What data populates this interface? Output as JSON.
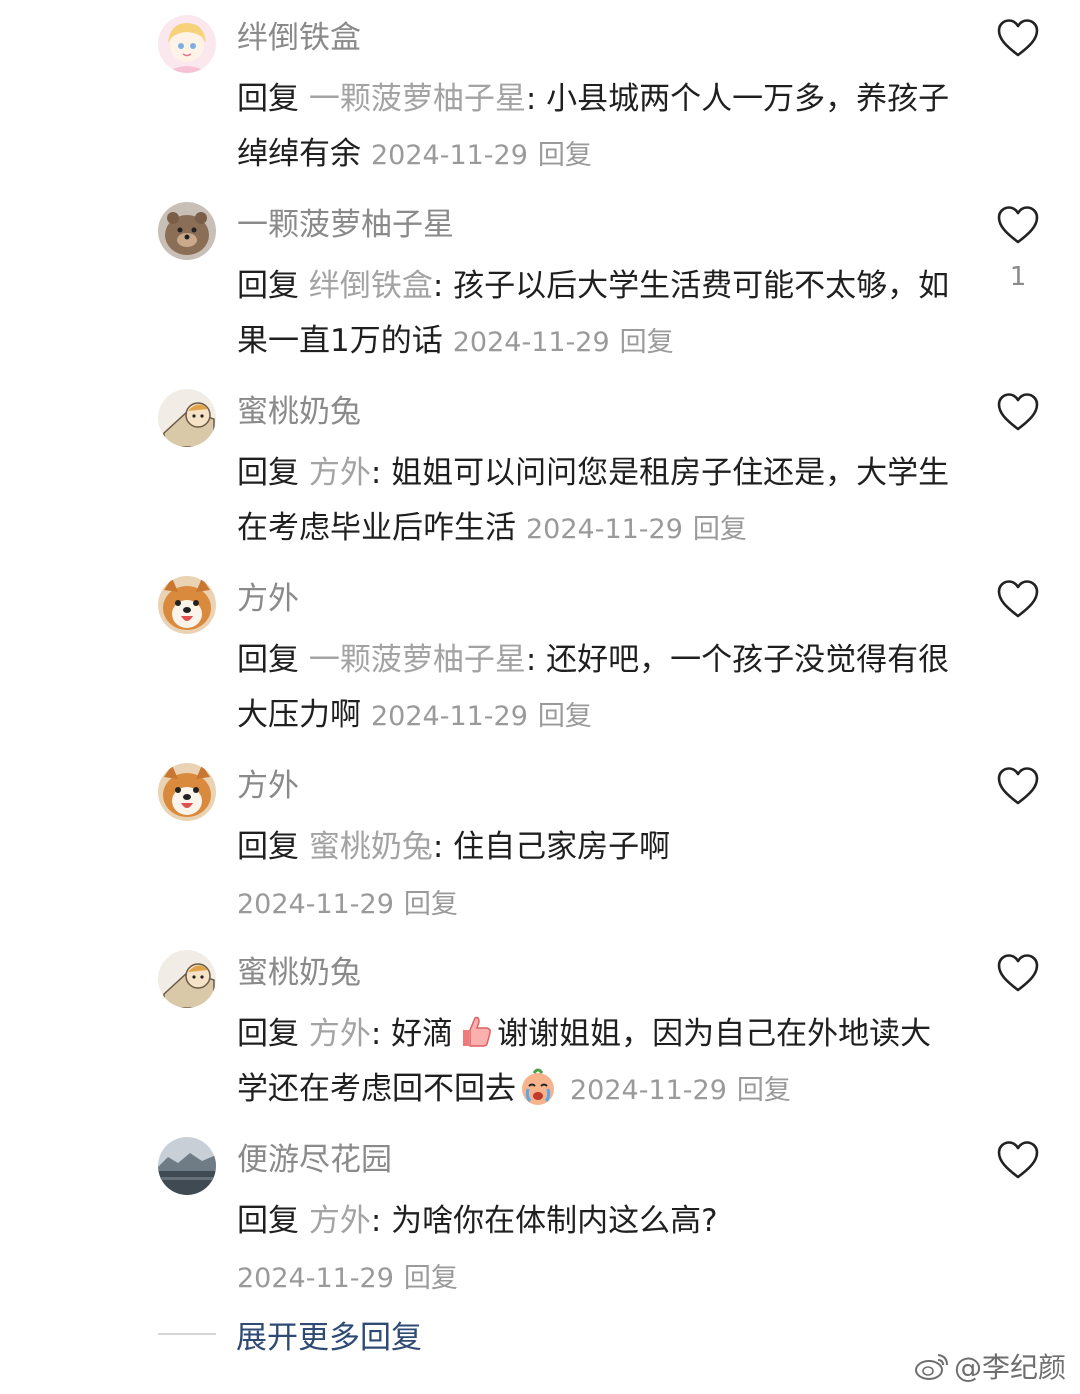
{
  "comments": [
    {
      "username": "绊倒铁盒",
      "prefix": "回复 ",
      "target": "一颗菠萝柚子星",
      "colon": ": ",
      "text": "小县城两个人一万多，养孩子绰绰有余",
      "date": "2024-11-29",
      "reply": "回复",
      "likes": ""
    },
    {
      "username": "一颗菠萝柚子星",
      "prefix": "回复 ",
      "target": "绊倒铁盒",
      "colon": ": ",
      "text": "孩子以后大学生活费可能不太够，如果一直1万的话",
      "date": "2024-11-29",
      "reply": "回复",
      "likes": "1"
    },
    {
      "username": "蜜桃奶兔",
      "prefix": "回复 ",
      "target": "方外",
      "colon": ": ",
      "text": "姐姐可以问问您是租房子住还是，大学生在考虑毕业后咋生活",
      "date": "2024-11-29",
      "reply": "回复",
      "likes": ""
    },
    {
      "username": "方外",
      "prefix": "回复 ",
      "target": "一颗菠萝柚子星",
      "colon": ": ",
      "text": "还好吧，一个孩子没觉得有很大压力啊",
      "date": "2024-11-29",
      "reply": "回复",
      "likes": ""
    },
    {
      "username": "方外",
      "prefix": "回复 ",
      "target": "蜜桃奶兔",
      "colon": ": ",
      "text": "住自己家房子啊",
      "date": "2024-11-29",
      "reply": "回复",
      "likes": ""
    },
    {
      "username": "蜜桃奶兔",
      "prefix": "回复 ",
      "target": "方外",
      "colon": ": ",
      "text_a": "好滴",
      "text_b": "谢谢姐姐，因为自己在外地读大学还在考虑回不回去",
      "date": "2024-11-29",
      "reply": "回复",
      "likes": ""
    },
    {
      "username": "便游尽花园",
      "prefix": "回复 ",
      "target": "方外",
      "colon": ": ",
      "text": "为啥你在体制内这么高?",
      "date": "2024-11-29",
      "reply": "回复",
      "likes": ""
    }
  ],
  "expand_label": "展开更多回复",
  "watermark": "@李纪颜",
  "colors": {
    "username": "#8a8a8a",
    "body": "#1f1f1f",
    "meta": "#9a9a9a",
    "link": "#2f4a73"
  }
}
